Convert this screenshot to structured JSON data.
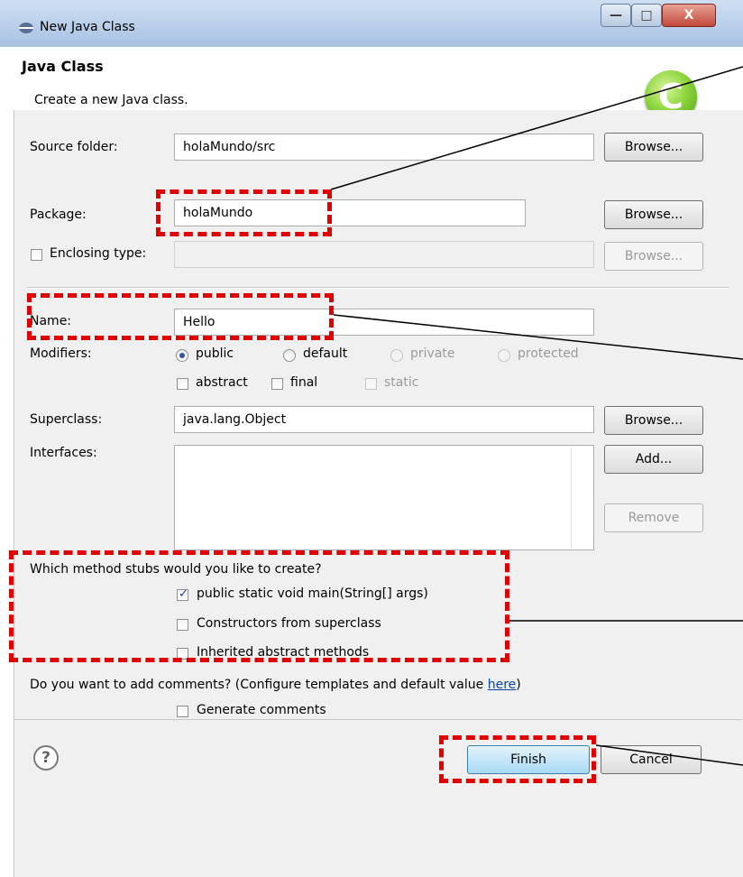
{
  "window": {
    "title": "New Java Class",
    "controls": {
      "minimize": "—",
      "maximize": "□",
      "close": "X"
    }
  },
  "header": {
    "title": "Java Class",
    "description": "Create a new Java class.",
    "logo_letter": "C"
  },
  "form": {
    "source_folder": {
      "label": "Source folder:",
      "value": "holaMundo/src",
      "button": "Browse..."
    },
    "package": {
      "label": "Package:",
      "value": "holaMundo",
      "button": "Browse..."
    },
    "enclosing_type": {
      "label": "Enclosing type:",
      "value": "",
      "checked": false,
      "button": "Browse..."
    },
    "name": {
      "label": "Name:",
      "value": "Hello"
    },
    "modifiers": {
      "label": "Modifiers:",
      "radios": [
        "public",
        "default",
        "private",
        "protected"
      ],
      "selected": "public",
      "checkboxes": [
        "abstract",
        "final",
        "static"
      ]
    },
    "superclass": {
      "label": "Superclass:",
      "value": "java.lang.Object",
      "button": "Browse..."
    },
    "interfaces": {
      "label": "Interfaces:",
      "add_button": "Add...",
      "remove_button": "Remove"
    },
    "stubs": {
      "question": "Which method stubs would you like to create?",
      "options": [
        "public static void main(String[] args)",
        "Constructors from superclass",
        "Inherited abstract methods"
      ],
      "checked": [
        true,
        false,
        false
      ]
    },
    "comments": {
      "question": "Do you want to add comments? (Configure templates and default value ",
      "link": "here",
      "question_end": ")",
      "option": "Generate comments"
    }
  },
  "footer": {
    "help": "?",
    "finish": "Finish",
    "cancel": "Cancel"
  },
  "colors": {
    "annotation": "#e00000",
    "accent": "#3c7fb1"
  }
}
